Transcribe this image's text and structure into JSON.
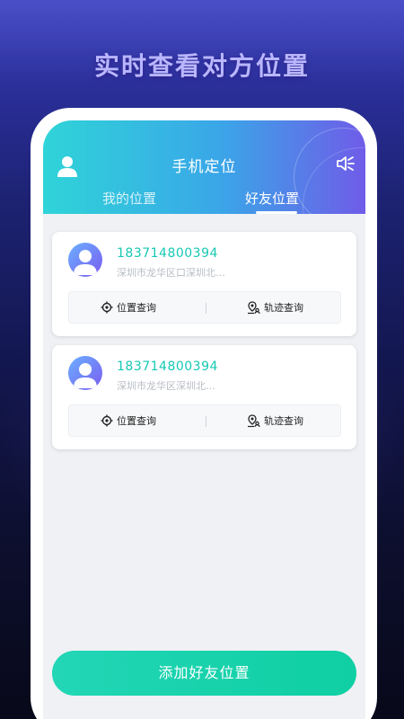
{
  "headline": "实时查看对方位置",
  "app": {
    "title": "手机定位",
    "tabs": [
      {
        "label": "我的位置"
      },
      {
        "label": "好友位置"
      }
    ]
  },
  "friends": [
    {
      "phone": "183714800394",
      "address": "深圳市龙华区口深圳北…",
      "locate_label": "位置查询",
      "track_label": "轨迹查询"
    },
    {
      "phone": "183714800394",
      "address": "深圳市龙华区深圳北…",
      "locate_label": "位置查询",
      "track_label": "轨迹查询"
    }
  ],
  "add_button": "添加好友位置",
  "colors": {
    "accent_teal": "#16c8b4",
    "header_start": "#2fd4d8",
    "header_end": "#6f5ce8",
    "button": "#0fcfa3"
  },
  "icons": {
    "header_left": "user-icon",
    "header_right": "speaker-icon",
    "locate": "crosshair-icon",
    "track": "pin-person-icon",
    "avatar": "avatar-icon"
  }
}
